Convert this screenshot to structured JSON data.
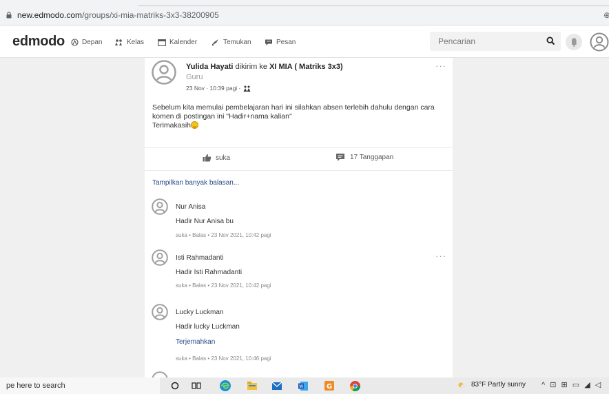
{
  "browser": {
    "url_host": "new.edmodo.com",
    "url_path": "/groups/xi-mia-matriks-3x3-38200905",
    "right_glyph": "⊕"
  },
  "navbar": {
    "logo": "edmodo",
    "items": [
      {
        "label": "Depan",
        "icon": "home-icon"
      },
      {
        "label": "Kelas",
        "icon": "class-icon"
      },
      {
        "label": "Kalender",
        "icon": "calendar-icon"
      },
      {
        "label": "Temukan",
        "icon": "discover-icon"
      },
      {
        "label": "Pesan",
        "icon": "message-icon"
      }
    ],
    "search_placeholder": "Pencarian"
  },
  "post": {
    "author": "Yulida Hayati",
    "sent_to_text": "dikirim ke",
    "group": "XI MIA ( Matriks 3x3)",
    "role": "Guru",
    "timestamp": "23 Nov · 10:39 pagi ·",
    "more": "···",
    "body_line1": "Sebelum kita memulai pembelajaran hari ini silahkan absen terlebih dahulu dengan cara",
    "body_line2": "komen di postingan ini \"Hadir+nama kalian\"",
    "body_line3": "Terimakasih",
    "like_label": "suka",
    "responses_label": "17 Tanggapan",
    "show_more_label": "Tampilkan banyak balasan..."
  },
  "comments": [
    {
      "name": "Nur Anisa",
      "text": "Hadir Nur Anisa bu",
      "translate": "",
      "meta": "suka  •  Balas  •  23 Nov 2021, 10:42 pagi"
    },
    {
      "name": "Isti Rahmadanti",
      "text": "Hadir Isti Rahmadanti",
      "translate": "",
      "meta": "suka  •  Balas  •  23 Nov 2021, 10:42 pagi",
      "more": "···"
    },
    {
      "name": "Lucky Luckman",
      "text": "Hadir lucky Luckman",
      "translate": "Terjemahkan",
      "meta": "suka  •  Balas  •  23 Nov 2021, 10:46 pagi"
    }
  ],
  "taskbar": {
    "search_text": "pe here to search",
    "weather": "83°F  Partly sunny",
    "tray": "^ ⊡ ⊞ ▭ ◢ ◁"
  },
  "colors": {
    "link": "#2a4a8a",
    "page_bg": "#f0f0f0"
  }
}
